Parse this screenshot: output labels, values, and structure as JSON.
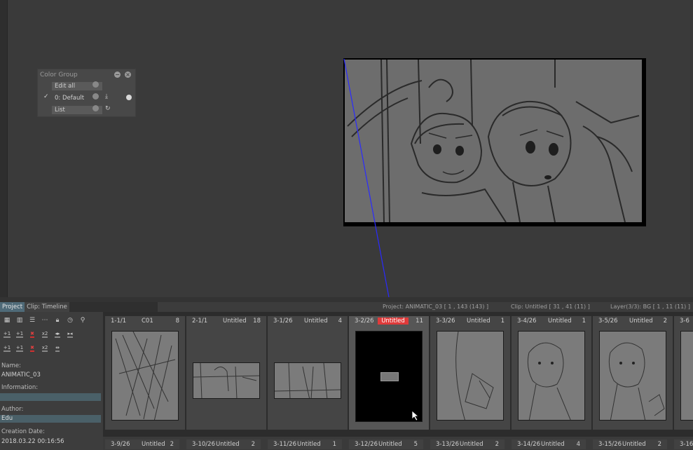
{
  "color_group": {
    "title": "Color Group",
    "edit_all": "Edit all",
    "default_group": "0: Default",
    "list": "List"
  },
  "tabs": [
    {
      "label": "Project"
    },
    {
      "label": "Clip: Timeline"
    }
  ],
  "status": {
    "project": "Project: ANIMATIC_03 [ 1 , 143  (143) ]",
    "clip": "Clip: Untitled [ 31 , 41  (11) ]",
    "layer": "Layer(3/3): BG [ 1 , 11  (11) ]"
  },
  "project_info": {
    "name_label": "Name:",
    "name_value": "ANIMATIC_03",
    "information_label": "Information:",
    "information_value": "",
    "author_label": "Author:",
    "author_value": "Edu",
    "creation_label": "Creation Date:",
    "creation_value": "2018.03.22 00:16:56"
  },
  "cuts_row1": [
    {
      "num": "1-1/1",
      "title": "C01",
      "count": "8",
      "selected": false
    },
    {
      "num": "2-1/1",
      "title": "Untitled",
      "count": "18",
      "selected": false
    },
    {
      "num": "3-1/26",
      "title": "Untitled",
      "count": "4",
      "selected": false
    },
    {
      "num": "3-2/26",
      "title": "Untitled",
      "count": "11",
      "selected": true
    },
    {
      "num": "3-3/26",
      "title": "Untitled",
      "count": "1",
      "selected": false
    },
    {
      "num": "3-4/26",
      "title": "Untitled",
      "count": "1",
      "selected": false
    },
    {
      "num": "3-5/26",
      "title": "Untitled",
      "count": "2",
      "selected": false
    },
    {
      "num": "3-6",
      "title": "",
      "count": "",
      "selected": false
    }
  ],
  "cuts_row2": [
    {
      "num": "3-9/26",
      "title": "Untitled",
      "count": "2"
    },
    {
      "num": "3-10/26",
      "title": "Untitled",
      "count": "2"
    },
    {
      "num": "3-11/26",
      "title": "Untitled",
      "count": "1"
    },
    {
      "num": "3-12/26",
      "title": "Untitled",
      "count": "5"
    },
    {
      "num": "3-13/26",
      "title": "Untitled",
      "count": "2"
    },
    {
      "num": "3-14/26",
      "title": "Untitled",
      "count": "4"
    },
    {
      "num": "3-15/26",
      "title": "Untitled",
      "count": "2"
    },
    {
      "num": "3-16",
      "title": "",
      "count": ""
    }
  ],
  "toolbar": {
    "plus_one": "+1",
    "x2": "x2"
  },
  "colors": {
    "selected_cut": "#e03a3a",
    "tab_active": "#4f6a78",
    "camera_line": "#2a2aff"
  }
}
